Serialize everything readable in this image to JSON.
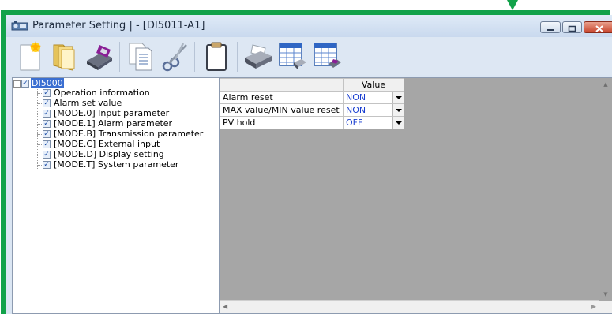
{
  "window": {
    "title": "Parameter Setting |  - [DI5011-A1]",
    "icon": "app-icon"
  },
  "titlebar_buttons": {
    "minimize": "minimize-icon",
    "maximize": "maximize-icon",
    "close": "close-icon"
  },
  "toolbar": {
    "buttons": [
      {
        "icon": "new-file-icon"
      },
      {
        "icon": "open-folder-icon"
      },
      {
        "icon": "save-disk-icon"
      },
      {
        "icon": "copy-document-icon"
      },
      {
        "icon": "scissors-icon"
      },
      {
        "icon": "clipboard-icon"
      },
      {
        "icon": "printer-icon"
      },
      {
        "icon": "read-device-icon"
      },
      {
        "icon": "write-device-icon"
      }
    ]
  },
  "tree": {
    "root": {
      "label": "DI5000",
      "checked": true,
      "expanded": true
    },
    "items": [
      {
        "label": "Operation information",
        "checked": true
      },
      {
        "label": "Alarm set value",
        "checked": true
      },
      {
        "label": "[MODE.0] Input parameter",
        "checked": true
      },
      {
        "label": "[MODE.1] Alarm parameter",
        "checked": true
      },
      {
        "label": "[MODE.B] Transmission parameter",
        "checked": true
      },
      {
        "label": "[MODE.C] External input",
        "checked": true
      },
      {
        "label": "[MODE.D] Display setting",
        "checked": true
      },
      {
        "label": "[MODE.T] System parameter",
        "checked": true
      }
    ]
  },
  "grid": {
    "column_header": "Value",
    "rows": [
      {
        "name": "Alarm reset",
        "value": "NON"
      },
      {
        "name": "MAX value/MIN value reset",
        "value": "NON"
      },
      {
        "name": "PV hold",
        "value": "OFF"
      }
    ]
  },
  "colors": {
    "highlight_frame": "#12a24a",
    "value_text": "#1a3fd0",
    "selection": "#3b6fd1",
    "grid_background": "#a6a6a6"
  }
}
